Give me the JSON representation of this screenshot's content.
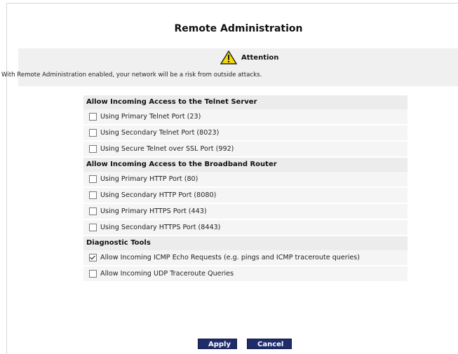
{
  "page": {
    "title": "Remote Administration"
  },
  "attention": {
    "label": "Attention",
    "message": "With Remote Administration enabled, your network will be a risk from outside attacks.",
    "icon": "warning-triangle-icon"
  },
  "sections": [
    {
      "title": "Allow Incoming Access to the Telnet Server",
      "options": [
        {
          "label": "Using Primary Telnet Port (23)",
          "checked": false
        },
        {
          "label": "Using Secondary Telnet Port (8023)",
          "checked": false
        },
        {
          "label": "Using Secure Telnet over SSL Port (992)",
          "checked": false
        }
      ]
    },
    {
      "title": "Allow Incoming Access to the Broadband Router",
      "options": [
        {
          "label": "Using Primary HTTP Port (80)",
          "checked": false
        },
        {
          "label": "Using Secondary HTTP Port (8080)",
          "checked": false
        },
        {
          "label": "Using Primary HTTPS Port (443)",
          "checked": false
        },
        {
          "label": "Using Secondary HTTPS Port (8443)",
          "checked": false
        }
      ]
    },
    {
      "title": "Diagnostic Tools",
      "options": [
        {
          "label": "Allow Incoming ICMP Echo Requests (e.g. pings and ICMP traceroute queries)",
          "checked": true
        },
        {
          "label": "Allow Incoming UDP Traceroute Queries",
          "checked": false
        }
      ]
    }
  ],
  "buttons": {
    "apply": "Apply",
    "cancel": "Cancel"
  },
  "colors": {
    "button_bg": "#1f2c6b",
    "section_bg": "#ececec",
    "row_bg": "#f5f5f5"
  }
}
